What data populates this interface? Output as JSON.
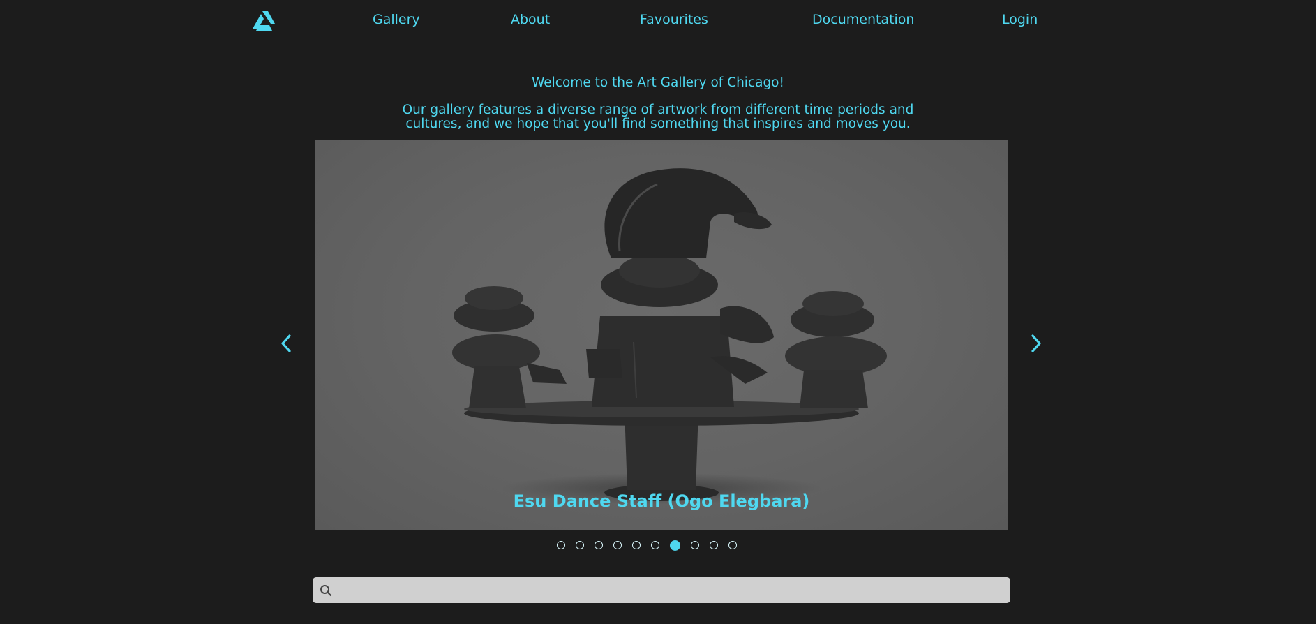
{
  "nav": {
    "logo_icon": "artstation-style-logo-icon",
    "links": [
      {
        "label": "Gallery"
      },
      {
        "label": "About"
      },
      {
        "label": "Favourites"
      },
      {
        "label": "Documentation"
      },
      {
        "label": "Login"
      }
    ]
  },
  "hero": {
    "welcome": "Welcome to the Art Gallery of Chicago!",
    "intro": "Our gallery features a diverse range of artwork from different time periods and cultures, and we hope that you'll find something that inspires and moves you."
  },
  "carousel": {
    "caption": "Esu Dance Staff (Ogo Elegbara)",
    "prev_icon": "chevron-left-icon",
    "next_icon": "chevron-right-icon",
    "slide_count": 10,
    "active_index": 6
  },
  "search": {
    "icon": "search-icon",
    "value": "",
    "placeholder": ""
  },
  "colors": {
    "background": "#1c1c1c",
    "accent": "#4fd8f0",
    "search_bg": "#d0d0d0"
  }
}
